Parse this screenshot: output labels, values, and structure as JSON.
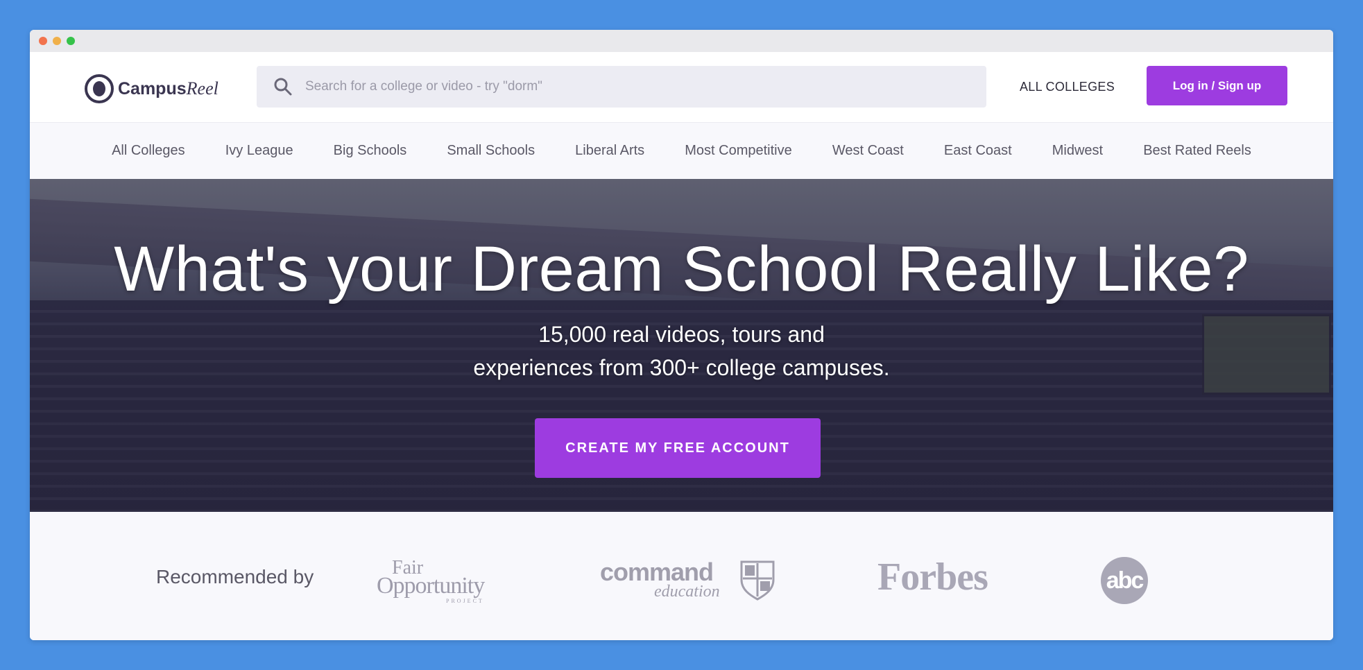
{
  "brand": {
    "name_bold": "Campus",
    "name_italic": "Reel"
  },
  "search": {
    "placeholder": "Search for a college or video - try \"dorm\""
  },
  "header": {
    "all_colleges_label": "ALL COLLEGES",
    "login_label": "Log in / Sign up"
  },
  "categories": [
    "All Colleges",
    "Ivy League",
    "Big Schools",
    "Small Schools",
    "Liberal Arts",
    "Most Competitive",
    "West Coast",
    "East Coast",
    "Midwest",
    "Best Rated Reels"
  ],
  "hero": {
    "title": "What's your Dream School Really Like?",
    "subtitle_line1": "15,000 real videos, tours and",
    "subtitle_line2": "experiences from 300+ college campuses.",
    "cta_label": "CREATE MY FREE ACCOUNT"
  },
  "recommended": {
    "label": "Recommended by",
    "logos": {
      "fair_line1": "Fair",
      "fair_line2": "Opportunity",
      "fair_line3": "PROJECT",
      "command_line1": "command",
      "command_line2": "education",
      "forbes": "Forbes",
      "abc": "abc"
    }
  },
  "colors": {
    "accent": "#9d3ce0",
    "background": "#4a90e2",
    "text_dark": "#3a3550",
    "muted_logo": "#a9a7b6"
  }
}
